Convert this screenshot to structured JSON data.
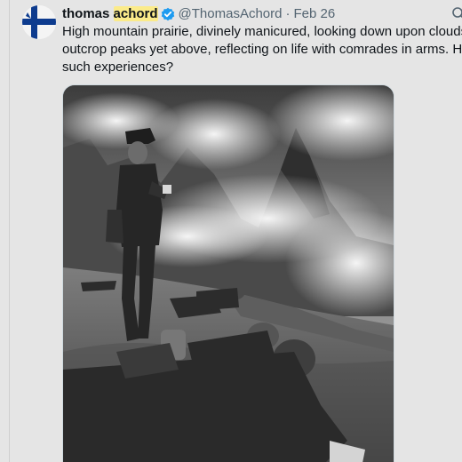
{
  "tweet": {
    "author": {
      "name_part1": "thomas ",
      "name_part2": "achord",
      "handle": "@ThomasAchord",
      "verified": true,
      "avatar_icon": "finnish-cross-flag-icon"
    },
    "separator": "·",
    "date": "Feb 26",
    "text_lines": [
      "High mountain prairie, divinely manicured, looking down upon clouds,",
      "outcrop peaks yet above, reflecting on life with comrades in arms. Have",
      "such experiences?"
    ],
    "media": {
      "type": "photo",
      "tone": "black-and-white"
    }
  },
  "colors": {
    "name_highlight": "#fbeb8a",
    "verified_badge": "#1d9bf0",
    "secondary_text": "#536471",
    "flag_blue": "#0d3b8e"
  }
}
